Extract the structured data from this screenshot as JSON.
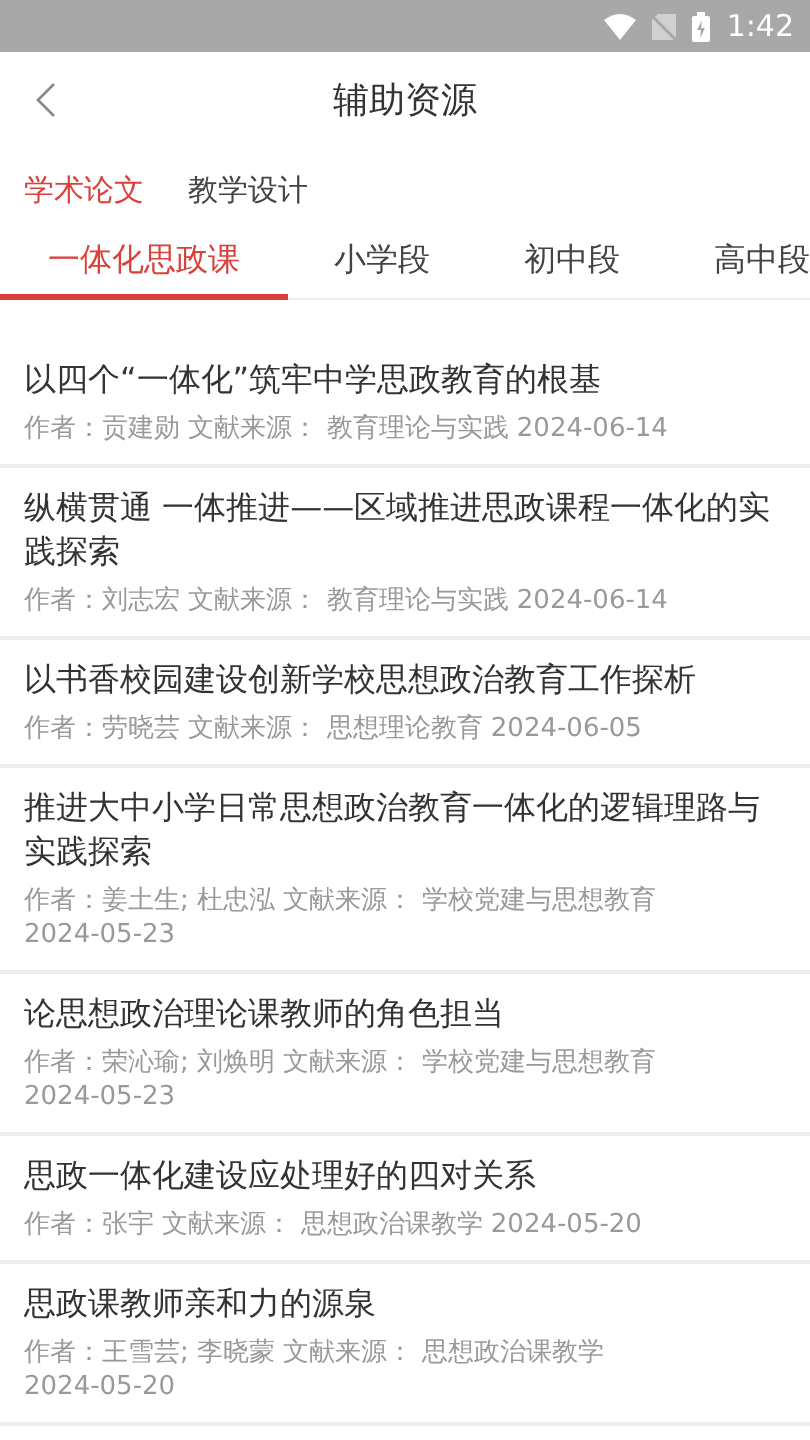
{
  "status_bar": {
    "time": "1:42"
  },
  "header": {
    "title": "辅助资源"
  },
  "categories": [
    {
      "label": "学术论文",
      "selected": true
    },
    {
      "label": "教学设计",
      "selected": false
    }
  ],
  "tabs": [
    {
      "label": "一体化思政课",
      "selected": true
    },
    {
      "label": "小学段",
      "selected": false
    },
    {
      "label": "初中段",
      "selected": false
    },
    {
      "label": "高中段",
      "selected": false
    }
  ],
  "articles": [
    {
      "title": "以四个“一体化”筑牢中学思政教育的根基",
      "meta": "作者：贡建勋 文献来源： 教育理论与实践 2024-06-14"
    },
    {
      "title": "纵横贯通 一体推进——区域推进思政课程一体化的实践探索",
      "meta": "作者：刘志宏 文献来源： 教育理论与实践 2024-06-14"
    },
    {
      "title": "以书香校园建设创新学校思想政治教育工作探析",
      "meta": "作者：劳晓芸 文献来源： 思想理论教育 2024-06-05"
    },
    {
      "title": "推进大中小学日常思想政治教育一体化的逻辑理路与实践探索",
      "meta": "作者：姜土生; 杜忠泓 文献来源： 学校党建与思想教育 2024-05-23"
    },
    {
      "title": "论思想政治理论课教师的角色担当",
      "meta": "作者：荣沁瑜; 刘焕明 文献来源： 学校党建与思想教育 2024-05-23"
    },
    {
      "title": "思政一体化建设应处理好的四对关系",
      "meta": "作者：张宇 文献来源： 思想政治课教学 2024-05-20"
    },
    {
      "title": "思政课教师亲和力的源泉",
      "meta": "作者：王雪芸; 李晓蒙 文献来源： 思想政治课教学 2024-05-20"
    }
  ]
}
